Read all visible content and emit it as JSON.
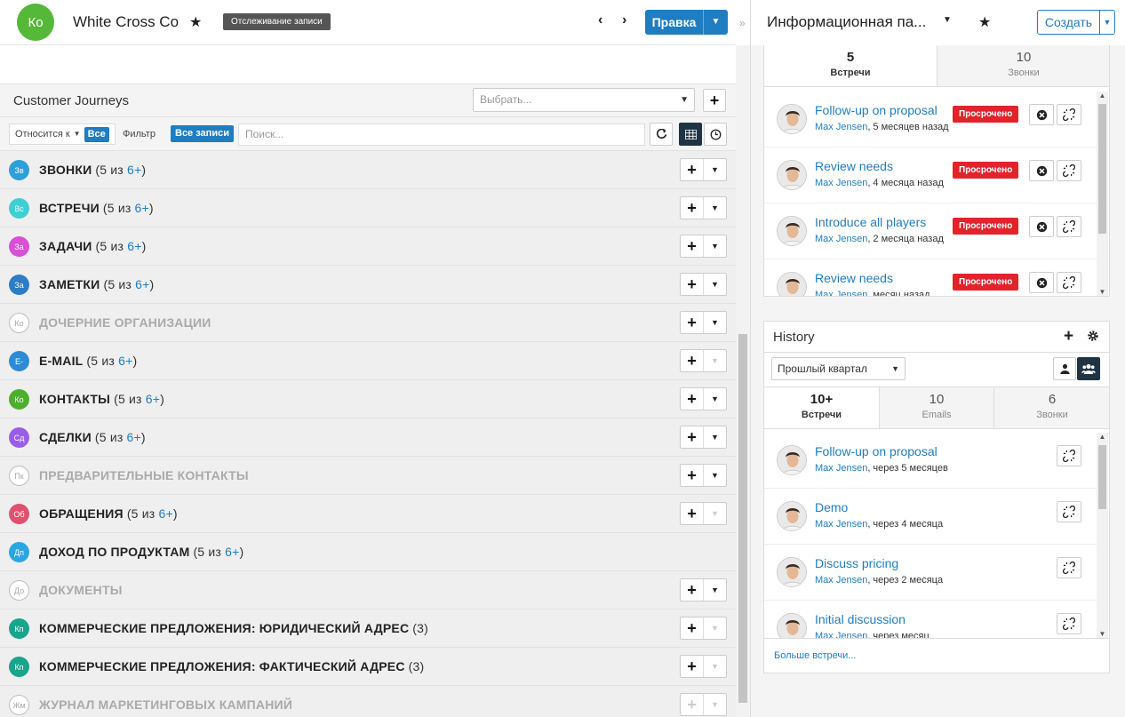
{
  "header": {
    "avatar_initials": "Ко",
    "record_title": "White Cross Co",
    "tracking_badge": "Отслеживание записи",
    "prev_arrow": "‹",
    "next_arrow": "›",
    "edit_label": "Правка",
    "collapse_arrow": "»"
  },
  "journeys": {
    "title": "Customer Journeys",
    "select_placeholder": "Выбрать..."
  },
  "filter_bar": {
    "related_label": "Относится к",
    "related_value": "Все",
    "filter_label": "Фильтр",
    "filter_value": "Все записи",
    "search_placeholder": "Поиск..."
  },
  "panels": [
    {
      "initials": "Зв",
      "color": "#2d9fd9",
      "name": "ЗВОНКИ",
      "count": "(5 из ",
      "more": "6+",
      "close": ")",
      "muted": false,
      "buttons": true,
      "dd_disabled": false
    },
    {
      "initials": "Вс",
      "color": "#3dcfd3",
      "name": "ВСТРЕЧИ",
      "count": "(5 из ",
      "more": "6+",
      "close": ")",
      "muted": false,
      "buttons": true,
      "dd_disabled": false
    },
    {
      "initials": "За",
      "color": "#d94fd8",
      "name": "ЗАДАЧИ",
      "count": "(5 из ",
      "more": "6+",
      "close": ")",
      "muted": false,
      "buttons": true,
      "dd_disabled": false
    },
    {
      "initials": "За",
      "color": "#2c7cc6",
      "name": "ЗАМЕТКИ",
      "count": "(5 из ",
      "more": "6+",
      "close": ")",
      "muted": false,
      "buttons": true,
      "dd_disabled": false
    },
    {
      "initials": "Ко",
      "color": "",
      "name": "ДОЧЕРНИЕ ОРГАНИЗАЦИИ",
      "count": "",
      "more": "",
      "close": "",
      "muted": true,
      "buttons": true,
      "dd_disabled": false
    },
    {
      "initials": "E-",
      "color": "#2c8bd6",
      "name": "E-MAIL",
      "count": "(5 из ",
      "more": "6+",
      "close": ")",
      "muted": false,
      "buttons": true,
      "dd_disabled": true
    },
    {
      "initials": "Ко",
      "color": "#4caf2e",
      "name": "КОНТАКТЫ",
      "count": "(5 из ",
      "more": "6+",
      "close": ")",
      "muted": false,
      "buttons": true,
      "dd_disabled": false
    },
    {
      "initials": "Сд",
      "color": "#9a5ee6",
      "name": "СДЕЛКИ",
      "count": "(5 из ",
      "more": "6+",
      "close": ")",
      "muted": false,
      "buttons": true,
      "dd_disabled": false
    },
    {
      "initials": "Пк",
      "color": "",
      "name": "ПРЕДВАРИТЕЛЬНЫЕ КОНТАКТЫ",
      "count": "",
      "more": "",
      "close": "",
      "muted": true,
      "buttons": true,
      "dd_disabled": false
    },
    {
      "initials": "Об",
      "color": "#e2506e",
      "name": "ОБРАЩЕНИЯ",
      "count": "(5 из ",
      "more": "6+",
      "close": ")",
      "muted": false,
      "buttons": true,
      "dd_disabled": true
    },
    {
      "initials": "Дп",
      "color": "#2aa6e0",
      "name": "ДОХОД ПО ПРОДУКТАМ",
      "count": "(5 из ",
      "more": "6+",
      "close": ")",
      "muted": false,
      "buttons": false,
      "dd_disabled": false
    },
    {
      "initials": "До",
      "color": "",
      "name": "ДОКУМЕНТЫ",
      "count": "",
      "more": "",
      "close": "",
      "muted": true,
      "buttons": true,
      "dd_disabled": false
    },
    {
      "initials": "Кп",
      "color": "#17a58c",
      "name": "КОММЕРЧЕСКИЕ ПРЕДЛОЖЕНИЯ: ЮРИДИЧЕСКИЙ АДРЕС",
      "count": "(3)",
      "more": "",
      "close": "",
      "muted": false,
      "buttons": true,
      "dd_disabled": true
    },
    {
      "initials": "Кп",
      "color": "#17a58c",
      "name": "КОММЕРЧЕСКИЕ ПРЕДЛОЖЕНИЯ: ФАКТИЧЕСКИЙ АДРЕС",
      "count": "(3)",
      "more": "",
      "close": "",
      "muted": false,
      "buttons": true,
      "dd_disabled": true
    },
    {
      "initials": "Жм",
      "color": "",
      "name": "ЖУРНАЛ МАРКЕТИНГОВЫХ КАМПАНИЙ",
      "count": "",
      "more": "",
      "close": "",
      "muted": true,
      "buttons": true,
      "dd_disabled": true,
      "plus_disabled": true
    }
  ],
  "dashboard": {
    "title": "Информационная па...",
    "create_label": "Создать"
  },
  "activities": {
    "tabs": [
      {
        "num": "5",
        "label": "Встречи",
        "active": true
      },
      {
        "num": "10",
        "label": "Звонки",
        "active": false
      }
    ],
    "items": [
      {
        "title": "Follow-up on proposal",
        "user": "Max Jensen",
        "when": ", 5 месяцев назад",
        "badge": "Просрочено"
      },
      {
        "title": "Review needs",
        "user": "Max Jensen",
        "when": ", 4 месяца назад",
        "badge": "Просрочено"
      },
      {
        "title": "Introduce all players",
        "user": "Max Jensen",
        "when": ", 2 месяца назад",
        "badge": "Просрочено"
      },
      {
        "title": "Review needs",
        "user": "Max Jensen",
        "when": ", месяц назад",
        "badge": "Просрочено"
      }
    ]
  },
  "history": {
    "title": "History",
    "filter_value": "Прошлый квартал",
    "tabs": [
      {
        "num": "10+",
        "label": "Встречи",
        "active": true
      },
      {
        "num": "10",
        "label": "Emails",
        "active": false
      },
      {
        "num": "6",
        "label": "Звонки",
        "active": false
      }
    ],
    "items": [
      {
        "title": "Follow-up on proposal",
        "user": "Max Jensen",
        "when": ", через 5 месяцев"
      },
      {
        "title": "Demo",
        "user": "Max Jensen",
        "when": ", через 4 месяца"
      },
      {
        "title": "Discuss pricing",
        "user": "Max Jensen",
        "when": ", через 2 месяца"
      },
      {
        "title": "Initial discussion",
        "user": "Max Jensen",
        "when": ", через месяц"
      }
    ],
    "more_link": "Больше встречи..."
  }
}
